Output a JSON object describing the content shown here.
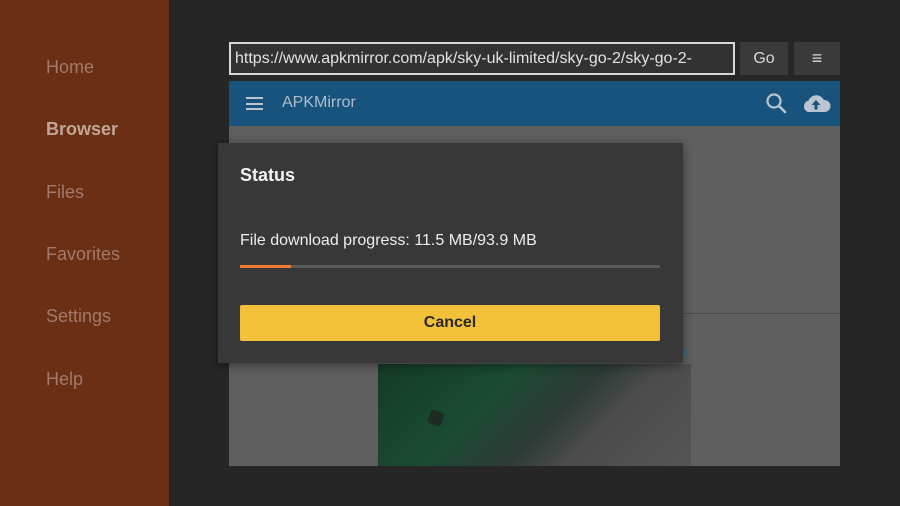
{
  "sidebar": {
    "items": [
      {
        "label": "Home"
      },
      {
        "label": "Browser",
        "active": true
      },
      {
        "label": "Files"
      },
      {
        "label": "Favorites"
      },
      {
        "label": "Settings"
      },
      {
        "label": "Help"
      }
    ]
  },
  "toolbar": {
    "url": "https://www.apkmirror.com/apk/sky-uk-limited/sky-go-2/sky-go-2-",
    "go_label": "Go",
    "menu_icon": "≡"
  },
  "webpage": {
    "site_title": "APKMirror",
    "icons": [
      "hamburger-icon",
      "search-icon",
      "upload-cloud-icon",
      "close-icon"
    ],
    "ad_close": "✕"
  },
  "dialog": {
    "title": "Status",
    "progress_text": "File download progress: 11.5 MB/93.9 MB",
    "progress_fraction": 0.122,
    "cancel_label": "Cancel"
  },
  "colors": {
    "sidebar_bg": "#6b2f14",
    "header_bg": "#17537c",
    "progress": "#f07d33",
    "cancel_button": "#f3c03a"
  }
}
